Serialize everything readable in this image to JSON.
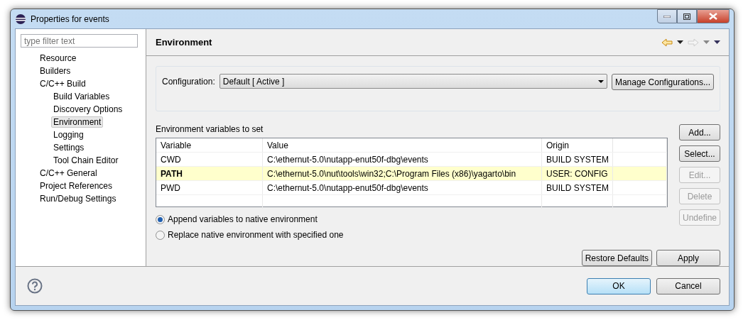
{
  "window": {
    "title": "Properties for events"
  },
  "filter": {
    "placeholder": "type filter text"
  },
  "tree": [
    {
      "label": "Resource",
      "selected": false
    },
    {
      "label": "Builders",
      "selected": false
    },
    {
      "label": "C/C++ Build",
      "selected": false,
      "children": [
        {
          "label": "Build Variables",
          "selected": false
        },
        {
          "label": "Discovery Options",
          "selected": false
        },
        {
          "label": "Environment",
          "selected": true
        },
        {
          "label": "Logging",
          "selected": false
        },
        {
          "label": "Settings",
          "selected": false
        },
        {
          "label": "Tool Chain Editor",
          "selected": false
        }
      ]
    },
    {
      "label": "C/C++ General",
      "selected": false
    },
    {
      "label": "Project References",
      "selected": false
    },
    {
      "label": "Run/Debug Settings",
      "selected": false
    }
  ],
  "page": {
    "title": "Environment",
    "back_enabled": true,
    "forward_enabled": false
  },
  "configuration": {
    "label": "Configuration:",
    "value": "Default  [ Active ]",
    "button": "Manage Configurations..."
  },
  "table": {
    "caption": "Environment variables to set",
    "columns": [
      "Variable",
      "Value",
      "Origin"
    ],
    "rows": [
      {
        "variable": "CWD",
        "value": "C:\\ethernut-5.0\\nutapp-enut50f-dbg\\events",
        "origin": "BUILD SYSTEM",
        "user_defined": false
      },
      {
        "variable": "PATH",
        "value": "C:\\ethernut-5.0\\nut\\tools\\win32;C:\\Program Files (x86)\\yagarto\\bin",
        "origin": "USER: CONFIG",
        "user_defined": true
      },
      {
        "variable": "PWD",
        "value": "C:\\ethernut-5.0\\nutapp-enut50f-dbg\\events",
        "origin": "BUILD SYSTEM",
        "user_defined": false
      }
    ]
  },
  "side_buttons": [
    {
      "label": "Add...",
      "disabled": false
    },
    {
      "label": "Select...",
      "disabled": false
    },
    {
      "label": "Edit...",
      "disabled": true
    },
    {
      "label": "Delete",
      "disabled": true
    },
    {
      "label": "Undefine",
      "disabled": true
    }
  ],
  "radios": [
    {
      "label": "Append variables to native environment",
      "selected": true
    },
    {
      "label": "Replace native environment with specified one",
      "selected": false
    }
  ],
  "page_buttons": [
    "Restore Defaults",
    "Apply"
  ],
  "dialog_buttons": [
    {
      "label": "OK",
      "default": true
    },
    {
      "label": "Cancel",
      "default": false
    }
  ]
}
